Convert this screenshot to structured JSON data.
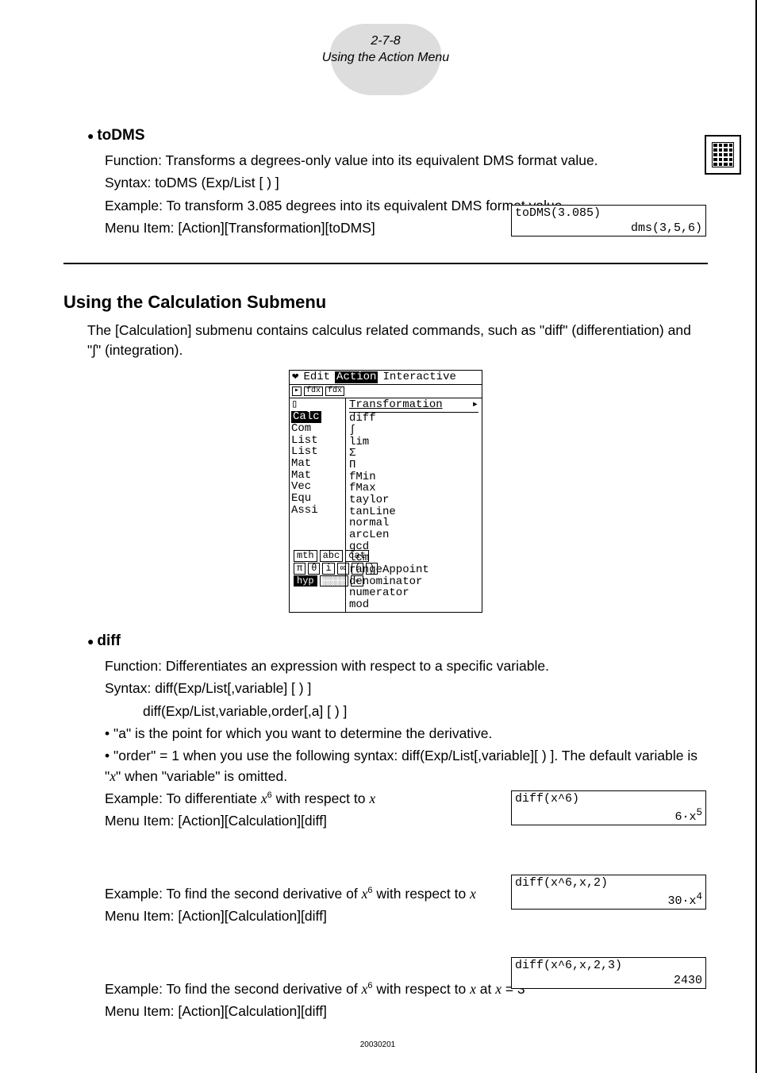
{
  "page_header": {
    "number": "2-7-8",
    "title": "Using the Action Menu"
  },
  "toDMS": {
    "heading": "toDMS",
    "function": "Function: Transforms a degrees-only value into its equivalent DMS format value.",
    "syntax": "Syntax: toDMS (Exp/List [ ) ]",
    "example": "Example: To transform 3.085 degrees into its equivalent DMS format value",
    "menu": "Menu Item: [Action][Transformation][toDMS]",
    "calc_in": "toDMS(3.085)",
    "calc_out": "dms(3,5,6)"
  },
  "submenu": {
    "heading": "Using the Calculation Submenu",
    "intro1": "The [Calculation] submenu contains calculus related commands, such as \"diff\" (differentiation) and \"∫\" (integration)."
  },
  "menu_screenshot": {
    "menubar": {
      "heart": "❤",
      "edit": "Edit",
      "action": "Action",
      "interactive": "Interactive"
    },
    "left_items": [
      "Calc",
      "Com",
      "List",
      "List",
      "Mat",
      "Mat",
      "Vec",
      "Equ",
      "Assi"
    ],
    "top_item": "Transformation",
    "right_items": [
      "diff",
      "∫",
      "lim",
      "Σ",
      "Π",
      "fMin",
      "fMax",
      "taylor",
      "tanLine",
      "normal",
      "arcLen",
      "gcd",
      "lcm",
      "rangeAppoint",
      "denominator",
      "numerator",
      "mod"
    ],
    "softkeys_row1": [
      "mth",
      "abc",
      "cat"
    ],
    "softkeys_row2": [
      "π",
      "θ",
      "i",
      "∞",
      "(",
      ")"
    ],
    "softkeys_hyp": "hyp"
  },
  "diff": {
    "heading": "diff",
    "function": "Function: Differentiates an expression with respect to a specific variable.",
    "syntax1": "Syntax: diff(Exp/List[,variable] [ ) ]",
    "syntax2": "diff(Exp/List,variable,order[,a] [ ) ]",
    "note_a": "\"a\" is the point for which you want to determine the derivative.",
    "note_order_pre": "\"order\" = 1 when you use the following syntax: diff(Exp/List[,variable][ ) ]. The default variable is \"",
    "note_order_var": "x",
    "note_order_post": "\" when \"variable\" is omitted.",
    "ex1_pre": "Example: To differentiate ",
    "ex1_mid": " with respect to ",
    "menu1": "Menu Item: [Action][Calculation][diff]",
    "calc1_in": "diff(x^6)",
    "calc1_out": "6·x",
    "calc1_out_sup": "5",
    "ex2_pre": "Example: To find the second derivative of ",
    "ex2_mid": " with respect to ",
    "menu2": "Menu Item: [Action][Calculation][diff]",
    "calc2_in": "diff(x^6,x,2)",
    "calc2_out": "30·x",
    "calc2_out_sup": "4",
    "ex3_pre": "Example: To find the second derivative of ",
    "ex3_mid": " with respect to ",
    "ex3_at": " at ",
    "ex3_eq": " = 3",
    "menu3": "Menu Item: [Action][Calculation][diff]",
    "calc3_in": "diff(x^6,x,2,3)",
    "calc3_out": "2430"
  },
  "var_x": "x",
  "exp_6": "6",
  "footer": "20030201"
}
